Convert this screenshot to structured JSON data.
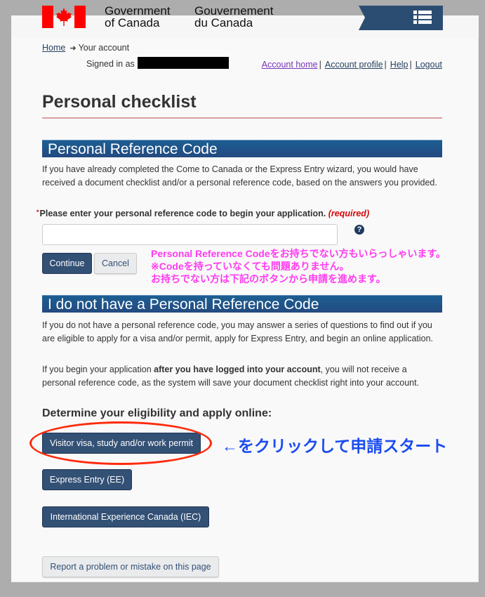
{
  "header": {
    "signature_en": [
      "Government",
      "of Canada"
    ],
    "signature_fr": [
      "Gouvernement",
      "du Canada"
    ],
    "menu_icon": "menu-list-icon"
  },
  "breadcrumb": {
    "home": "Home",
    "arrow": "➜",
    "current": "Your account"
  },
  "account_bar": {
    "signed_in_label": "Signed in as",
    "links": [
      "Account home",
      "Account profile",
      "Help",
      "Logout"
    ],
    "separator": "|"
  },
  "page_title": "Personal checklist",
  "section1": {
    "heading": "Personal Reference Code",
    "intro": "If you have already completed the Come to Canada or the Express Entry wizard, you would have received a document checklist and/or a personal reference code, based on the answers you provided.",
    "field_label_star": "*",
    "field_label": "Please enter your personal reference code to begin your application.",
    "field_required": "(required)",
    "field_value": "",
    "help_icon": "?",
    "continue_label": "Continue",
    "cancel_label": "Cancel"
  },
  "annotation_note": [
    "Personal Reference Codeをお持ちでない方もいらっしゃいます。",
    "※Codeを持っていなくても問題ありません。",
    "お持ちでない方は下記のボタンから申請を進めます。"
  ],
  "section2": {
    "heading": "I do not have a Personal Reference Code",
    "para1": "If you do not have a personal reference code, you may answer a series of questions to find out if you are eligible to apply for a visa and/or permit, apply for Express Entry, and begin an online application.",
    "para2_pre": "If you begin your application ",
    "para2_bold": "after you have logged into your account",
    "para2_post": ", you will not receive a personal reference code, as the system will save your document checklist right into your account.",
    "subheading": "Determine your eligibility and apply online:",
    "buttons": [
      "Visitor visa, study and/or work permit",
      "Express Entry (EE)",
      "International Experience Canada (IEC)"
    ]
  },
  "annotation_arrow": "←をクリックして申請スタート",
  "report_button": "Report a problem or mistake on this page",
  "colors": {
    "primary_button": "#335075",
    "section_header": "#1c5e92",
    "annotation_pink": "#ff3cf0",
    "annotation_blue": "#1a4cf0",
    "highlight_oval": "#ff2a0a",
    "required_red": "#d3080c"
  }
}
